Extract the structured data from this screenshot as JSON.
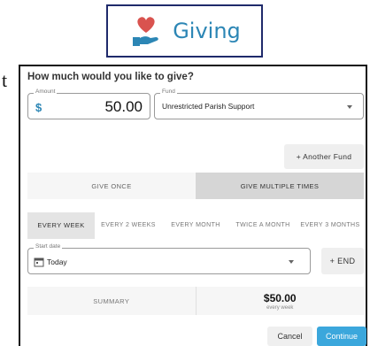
{
  "header": {
    "title": "Giving",
    "icon": "heart-hand-icon"
  },
  "stray_text": "t",
  "form": {
    "question": "How much would you like to give?",
    "amount": {
      "label": "Amount",
      "currency": "$",
      "value": "50.00"
    },
    "fund": {
      "label": "Fund",
      "value": "Unrestricted Parish Support"
    },
    "another_fund_label": "+ Another Fund",
    "frequency": {
      "options": [
        "GIVE ONCE",
        "GIVE MULTIPLE TIMES"
      ],
      "selected": "GIVE MULTIPLE TIMES"
    },
    "intervals": {
      "options": [
        "EVERY WEEK",
        "EVERY 2 WEEKS",
        "EVERY MONTH",
        "TWICE A MONTH",
        "EVERY 3 MONTHS"
      ],
      "selected": "EVERY WEEK"
    },
    "start_date": {
      "label": "Start date",
      "value": "Today",
      "icon": "calendar-icon"
    },
    "end_label": "+ END",
    "summary": {
      "label": "SUMMARY",
      "total": "$50.00",
      "period": "every week"
    },
    "cancel_label": "Cancel",
    "continue_label": "Continue"
  },
  "colors": {
    "accent": "#3ba7dc",
    "title": "#2c86b5",
    "heart": "#d9534f",
    "header_border": "#1f2a6b"
  }
}
